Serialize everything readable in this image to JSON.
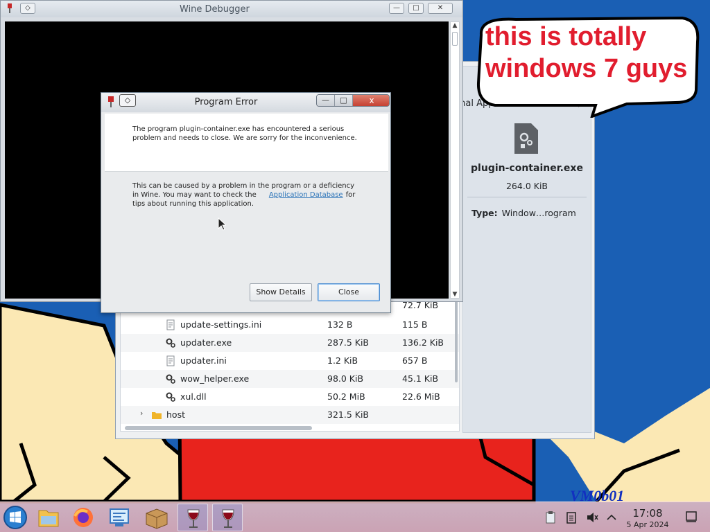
{
  "colors": {
    "desktop": "#1a5fb4",
    "bubble_text": "#e11d2e",
    "signature": "#1230c0",
    "taskbar": "#e8bcc4",
    "dialog_close": "#c2392a",
    "link": "#2a73b8"
  },
  "wine_debugger": {
    "title": "Wine Debugger"
  },
  "error_dialog": {
    "title": "Program Error",
    "message_primary": "The program plugin-container.exe has encountered a serious problem and needs to close. We are sorry for the inconvenience.",
    "message_secondary_before": "This can be caused by a problem in the program or a deficiency in Wine. You may want to check the",
    "link_text": "Application Database",
    "message_secondary_after": "for tips about running this application.",
    "show_details_label": "Show Details",
    "close_label": "Close",
    "minimize_glyph": "—",
    "maximize_glyph": "□",
    "close_glyph": "x"
  },
  "archive": {
    "partial_size_row": {
      "compressed": "72.7 KiB"
    },
    "files": [
      {
        "name": "update-settings.ini",
        "size": "132 B",
        "compressed": "115 B",
        "icon": "text-file-icon"
      },
      {
        "name": "updater.exe",
        "size": "287.5 KiB",
        "compressed": "136.2 KiB",
        "icon": "executable-icon"
      },
      {
        "name": "updater.ini",
        "size": "1.2 KiB",
        "compressed": "657 B",
        "icon": "text-file-icon"
      },
      {
        "name": "wow_helper.exe",
        "size": "98.0 KiB",
        "compressed": "45.1 KiB",
        "icon": "executable-icon"
      },
      {
        "name": "xul.dll",
        "size": "50.2 MiB",
        "compressed": "22.6 MiB",
        "icon": "executable-icon"
      },
      {
        "name": "host",
        "size": "321.5 KiB",
        "compressed": "",
        "icon": "folder-icon"
      }
    ],
    "info": {
      "app_type": "ernal Application",
      "filename": "plugin-container.exe",
      "filesize": "264.0 KiB",
      "type_label": "Type:",
      "type_value": "Window…rogram"
    }
  },
  "desktop": {
    "bubble_line1": "this is totally",
    "bubble_line2": "windows 7 guys",
    "signature": "VM0b01"
  },
  "taskbar": {
    "icons": [
      "start-orb-icon",
      "file-manager-icon",
      "firefox-icon",
      "system-settings-icon",
      "archive-icon",
      "wine-icon",
      "wine-icon"
    ],
    "clock_time": "17:08",
    "clock_date": "5 Apr 2024"
  }
}
